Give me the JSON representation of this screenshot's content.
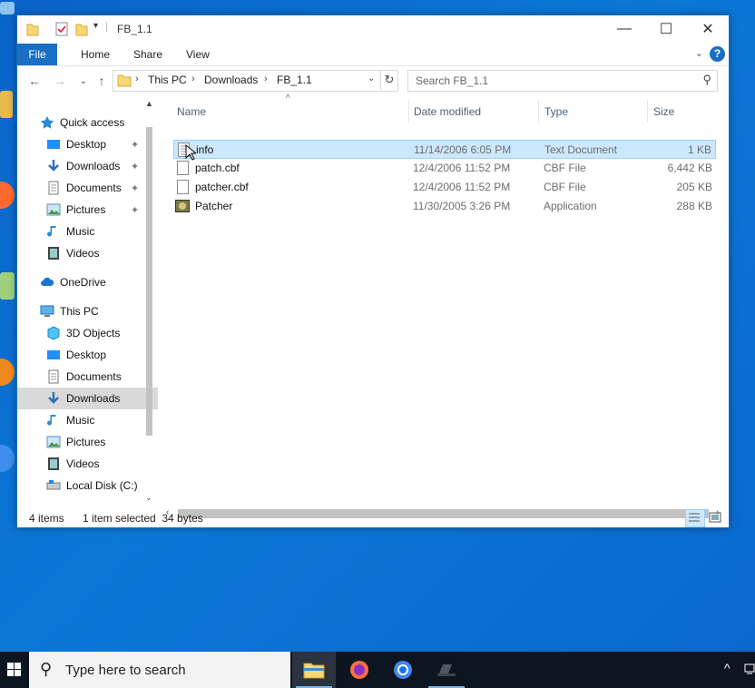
{
  "window": {
    "title": "FB_1.1",
    "controls": {
      "minimize": "—",
      "maximize": "☐",
      "close": "✕"
    }
  },
  "ribbon": {
    "tabs": [
      "File",
      "Home",
      "Share",
      "View"
    ],
    "help": "?"
  },
  "address": {
    "crumbs": [
      "This PC",
      "Downloads",
      "FB_1.1"
    ],
    "search_placeholder": "Search FB_1.1"
  },
  "nav_pane": {
    "items": [
      {
        "label": "Quick access",
        "icon": "star-icon"
      },
      {
        "label": "Desktop",
        "icon": "desktop-icon",
        "pinned": true
      },
      {
        "label": "Downloads",
        "icon": "download-icon",
        "pinned": true
      },
      {
        "label": "Documents",
        "icon": "documents-icon",
        "pinned": true
      },
      {
        "label": "Pictures",
        "icon": "pictures-icon",
        "pinned": true
      },
      {
        "label": "Music",
        "icon": "music-icon"
      },
      {
        "label": "Videos",
        "icon": "videos-icon"
      },
      {
        "label": "OneDrive",
        "icon": "cloud-icon"
      },
      {
        "label": "This PC",
        "icon": "computer-icon"
      },
      {
        "label": "3D Objects",
        "icon": "cube-icon"
      },
      {
        "label": "Desktop",
        "icon": "desktop-icon"
      },
      {
        "label": "Documents",
        "icon": "documents-icon"
      },
      {
        "label": "Downloads",
        "icon": "download-icon",
        "selected": true
      },
      {
        "label": "Music",
        "icon": "music-icon"
      },
      {
        "label": "Pictures",
        "icon": "pictures-icon"
      },
      {
        "label": "Videos",
        "icon": "videos-icon"
      },
      {
        "label": "Local Disk (C:)",
        "icon": "drive-icon"
      }
    ]
  },
  "file_list": {
    "columns": [
      "Name",
      "Date modified",
      "Type",
      "Size"
    ],
    "rows": [
      {
        "name": "info",
        "date": "11/14/2006 6:05 PM",
        "type": "Text Document",
        "size": "1 KB",
        "icon": "text-file-icon",
        "selected": true
      },
      {
        "name": "patch.cbf",
        "date": "12/4/2006 11:52 PM",
        "type": "CBF File",
        "size": "6,442 KB",
        "icon": "blank-file-icon"
      },
      {
        "name": "patcher.cbf",
        "date": "12/4/2006 11:52 PM",
        "type": "CBF File",
        "size": "205 KB",
        "icon": "blank-file-icon"
      },
      {
        "name": "Patcher",
        "date": "11/30/2005 3:26 PM",
        "type": "Application",
        "size": "288 KB",
        "icon": "app-icon"
      }
    ]
  },
  "status": {
    "count": "4 items",
    "selection": "1 item selected  34 bytes"
  },
  "taskbar": {
    "search_placeholder": "Type here to search",
    "apps": [
      "file-explorer-icon",
      "firefox-icon",
      "chrome-icon",
      "app-window-icon"
    ]
  },
  "colors": {
    "accent": "#1a6fc4",
    "selected_row": "#cce8ff",
    "desktop": "#0b6fd0"
  }
}
